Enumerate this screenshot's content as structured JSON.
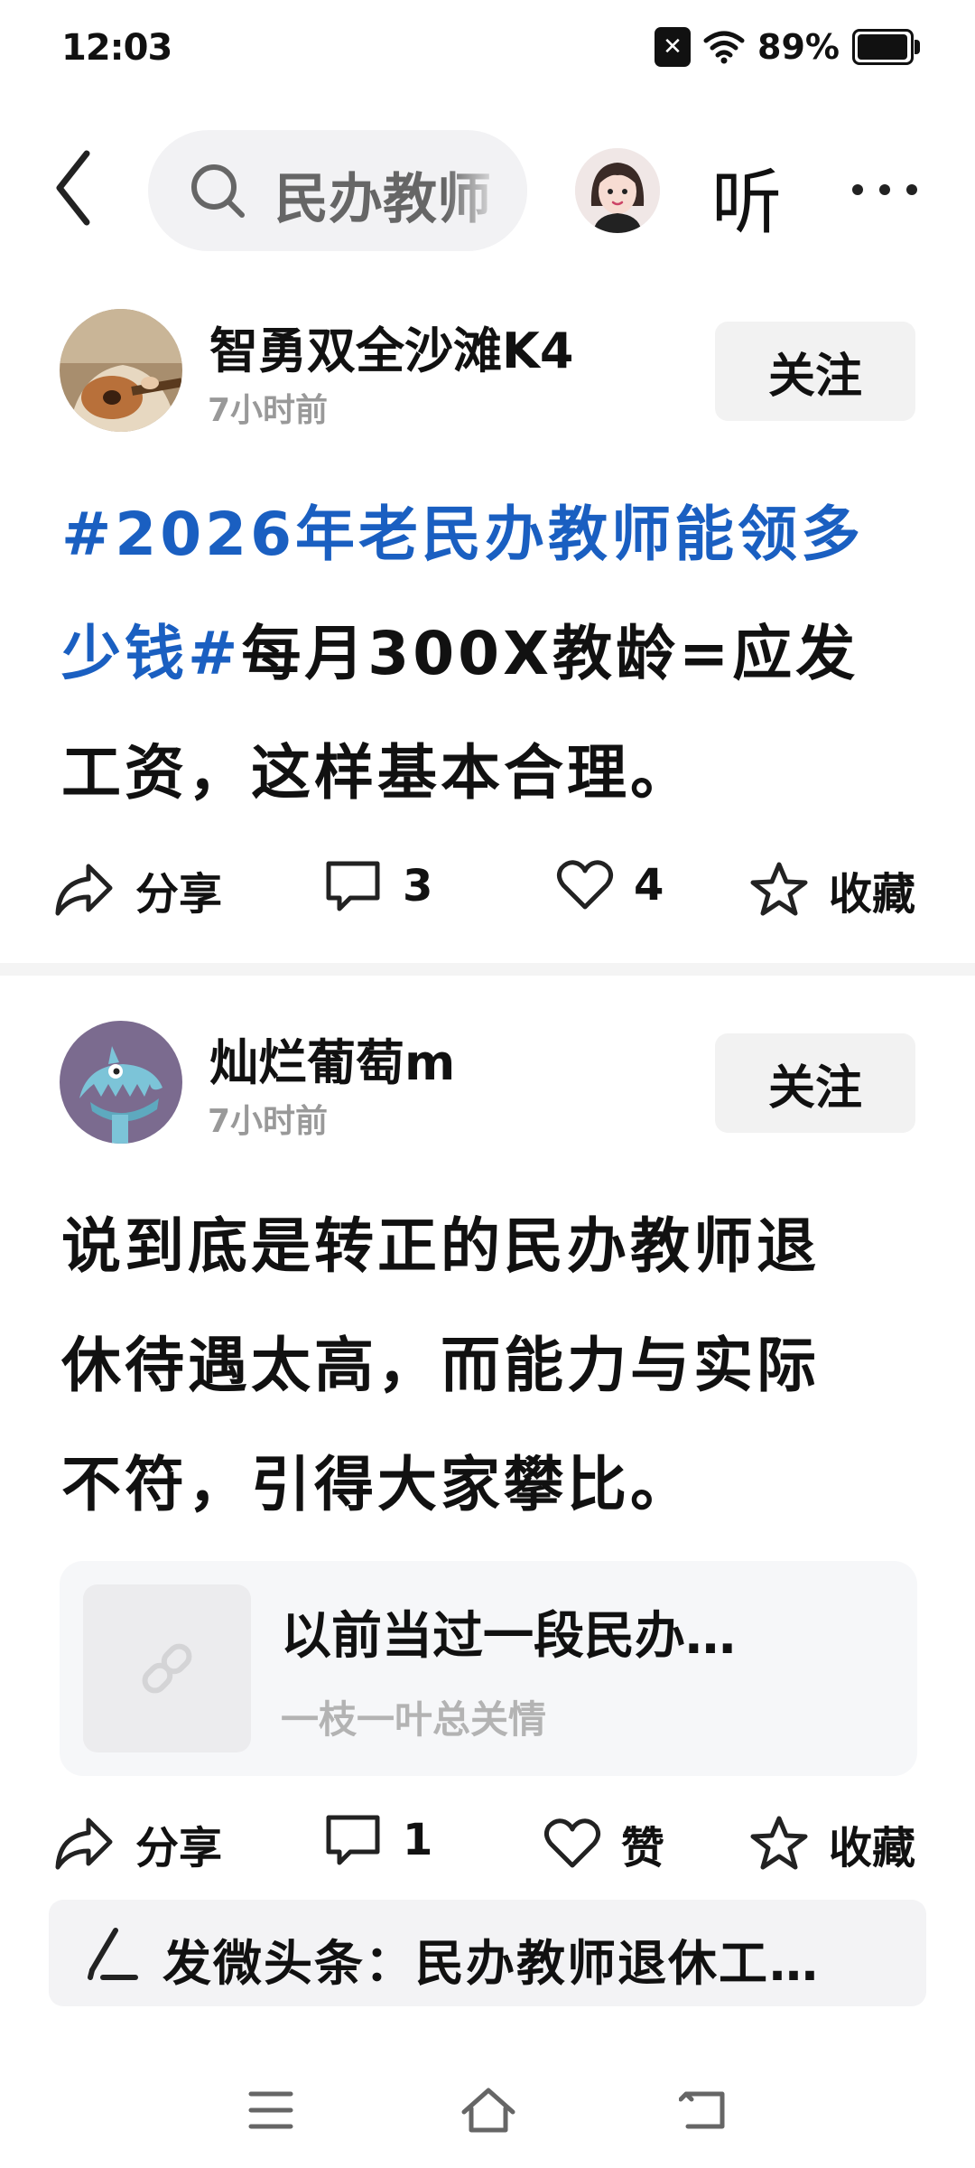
{
  "status_bar": {
    "time": "12:03",
    "battery_text": "89%",
    "battery_level": 0.89
  },
  "header": {
    "search_text": "民办教师",
    "listen_label": "听"
  },
  "posts": [
    {
      "author": "智勇双全沙滩K4",
      "time": "7小时前",
      "follow_label": "关注",
      "hashtag_line1": "#2026年老民办教师能领多",
      "hashtag_line2": "少钱#",
      "text_line2_rest": "每月300X教龄=应发",
      "text_line3": "工资，这样基本合理。",
      "actions": {
        "share": "分享",
        "comments": "3",
        "likes": "4",
        "collect": "收藏"
      }
    },
    {
      "author": "灿烂葡萄m",
      "time": "7小时前",
      "follow_label": "关注",
      "text_line1": "说到底是转正的民办教师退",
      "text_line2": "休待遇太高，而能力与实际",
      "text_line3": "不符，引得大家攀比。",
      "link_card": {
        "title": "以前当过一段民办…",
        "source": "一枝一叶总关情"
      },
      "actions": {
        "share": "分享",
        "comments": "1",
        "likes": "赞",
        "collect": "收藏"
      }
    }
  ],
  "compose_bar": {
    "text": "发微头条：民办教师退休工…"
  },
  "icons": {
    "back": "back-arrow-icon",
    "search": "search-icon",
    "more": "more-icon",
    "share": "share-icon",
    "comment": "comment-icon",
    "like": "heart-icon",
    "collect": "star-icon",
    "pen": "pen-icon",
    "link": "link-icon",
    "menu": "menu-icon",
    "home": "home-icon",
    "return": "return-icon"
  },
  "colors": {
    "hashtag": "#1a5fc1",
    "background": "#ffffff",
    "secondary_text": "#999999"
  }
}
